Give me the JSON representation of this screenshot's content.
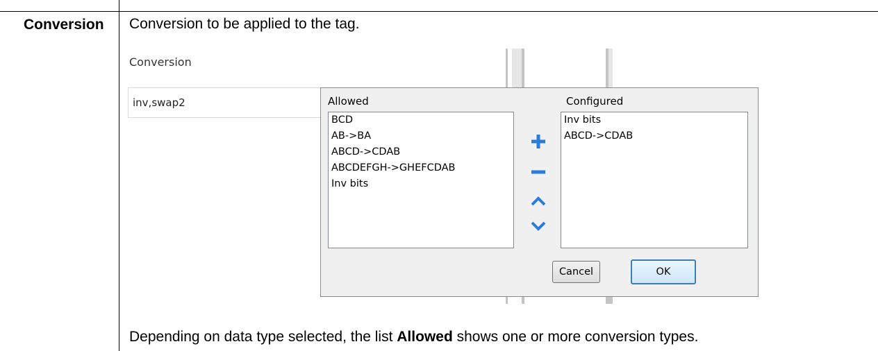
{
  "parameter": {
    "name": "Conversion",
    "description": "Conversion to be applied to the tag."
  },
  "screenshot": {
    "field_label": "Conversion",
    "field_value": "inv,swap2",
    "dialog": {
      "allowed_label": "Allowed",
      "allowed_items": [
        "BCD",
        "AB->BA",
        "ABCD->CDAB",
        "ABCDEFGH->GHEFCDAB",
        "Inv bits"
      ],
      "configured_label": "Configured",
      "configured_items": [
        "Inv bits",
        "ABCD->CDAB"
      ],
      "controls": {
        "add": "+",
        "remove": "−",
        "up": "⌃",
        "down": "⌄"
      },
      "cancel_label": "Cancel",
      "ok_label": "OK"
    }
  },
  "footer": {
    "before": "Depending on data type selected, the list ",
    "bold": "Allowed",
    "after": " shows one or more conversion types."
  },
  "colors": {
    "accent": "#2a7bde"
  }
}
